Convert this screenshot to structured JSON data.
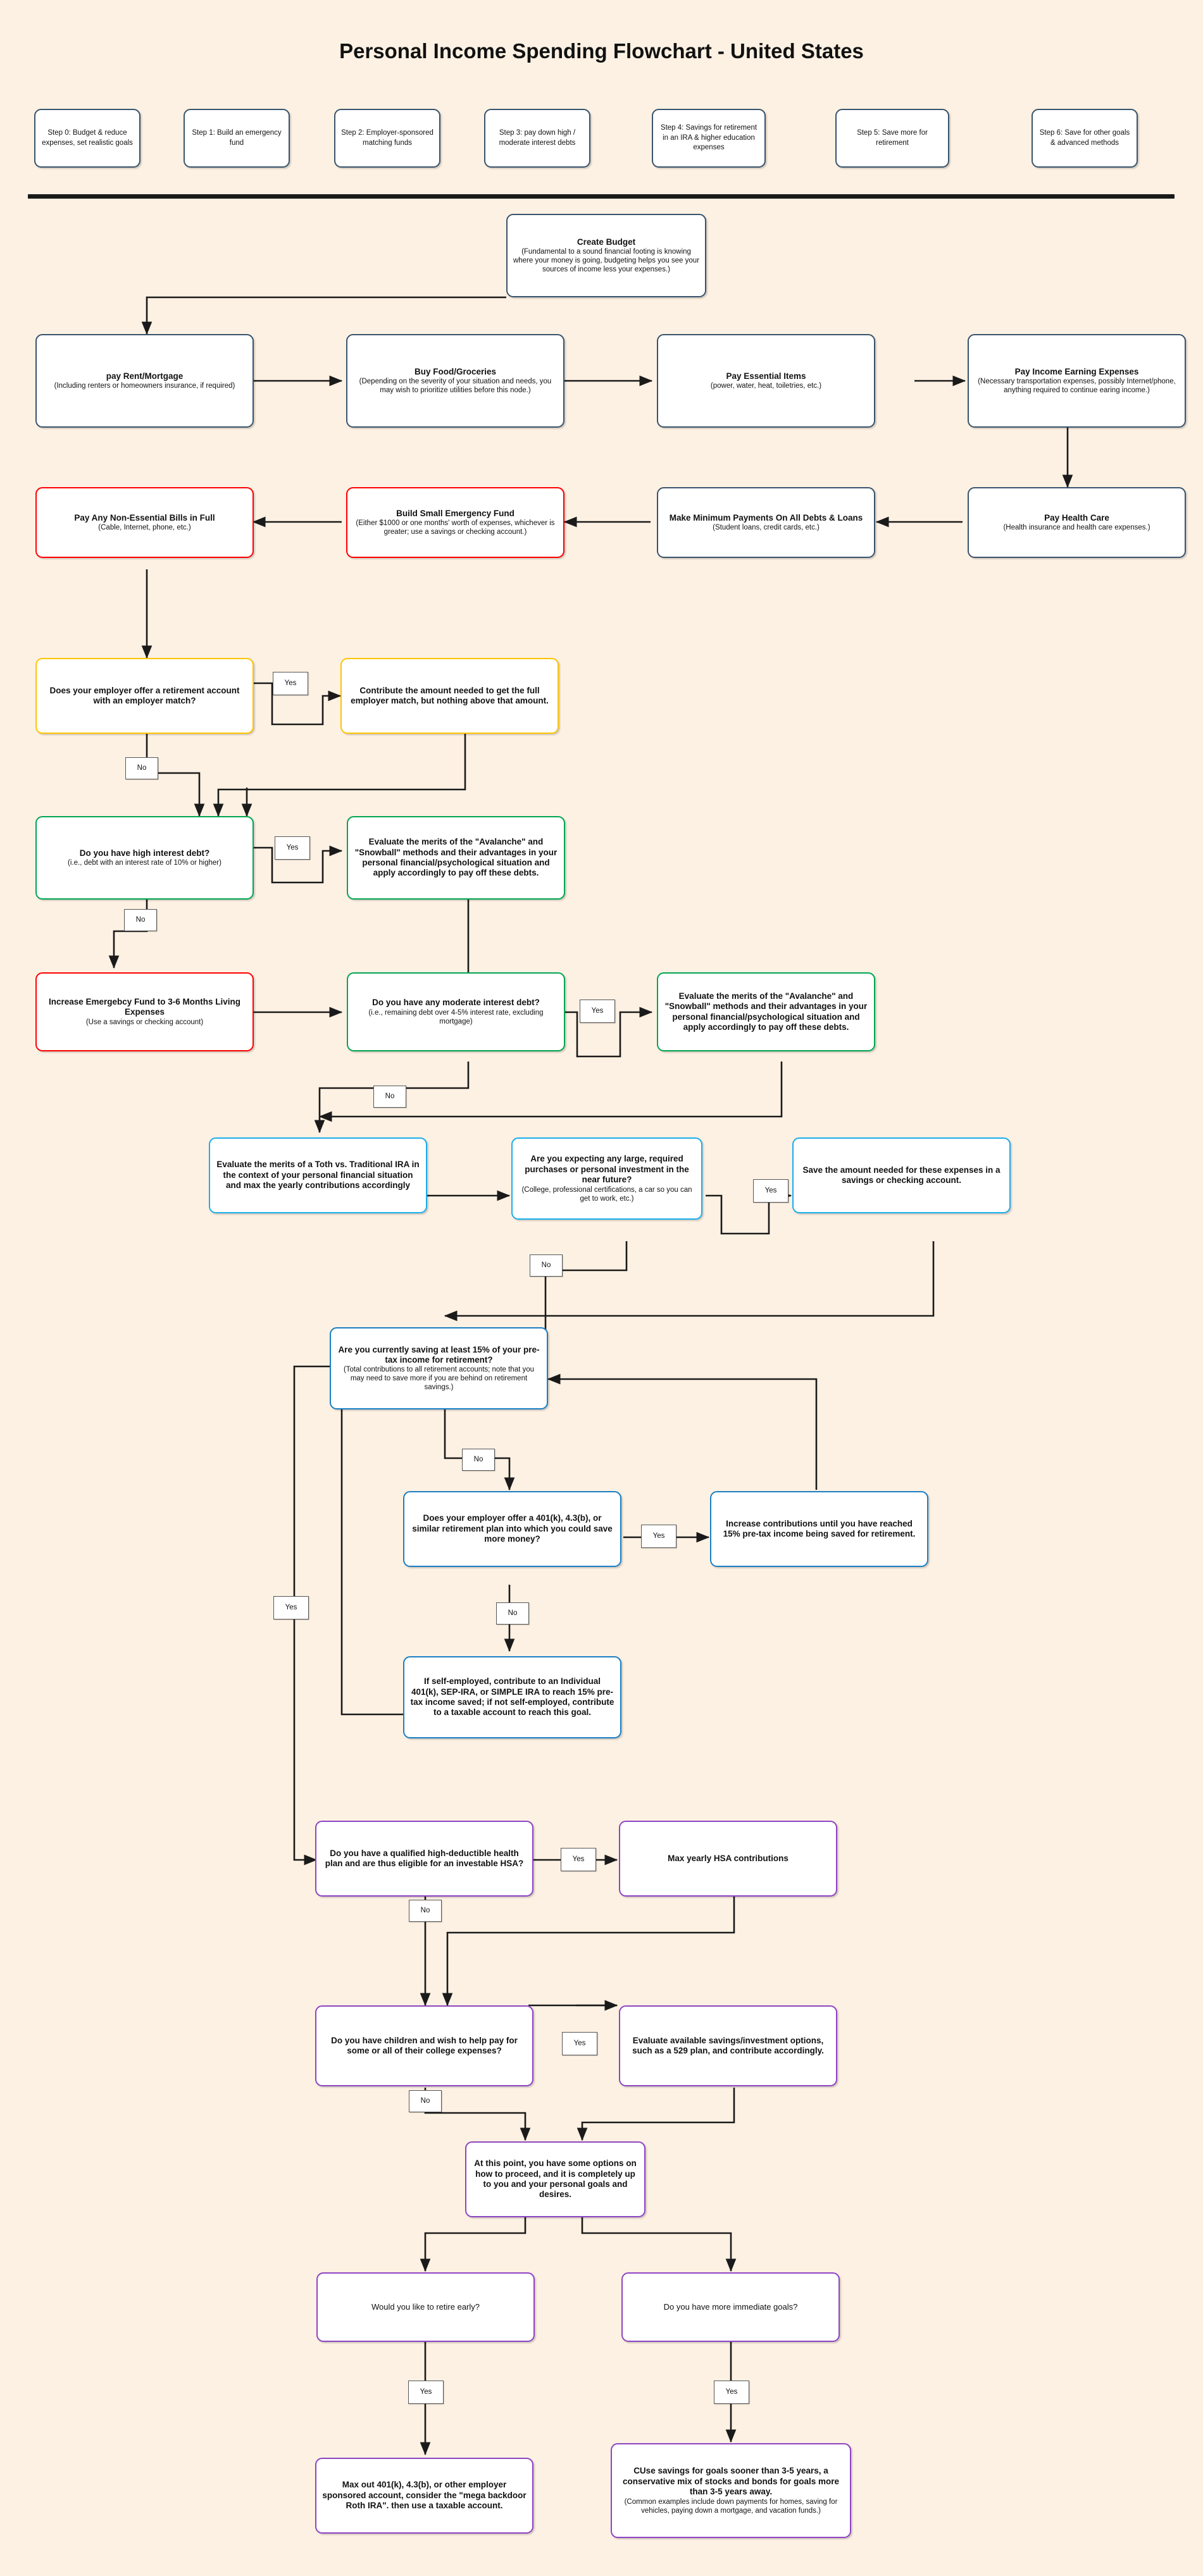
{
  "page": {
    "title": "Personal Income Spending Flowchart - United States",
    "background_color": "#fdf1e3"
  },
  "legend": {
    "items": [
      {
        "label": "Step 0: Budget & reduce expenses, set realistic goals",
        "color": "#39546d"
      },
      {
        "label": "Step 1: Build an emergency fund",
        "color": "#ff0000"
      },
      {
        "label": "Step 2: Employer-sponsored matching funds",
        "color": "#ffc400"
      },
      {
        "label": "Step 3: pay down high / moderate interest debts",
        "color": "#00a651"
      },
      {
        "label": "Step 4: Savings for retirement in an IRA & higher education expenses",
        "color": "#1aaeec"
      },
      {
        "label": "Step 5: Save more for retirement",
        "color": "#1a7fc4"
      },
      {
        "label": "Step 6: Save for other goals & advanced methods",
        "color": "#8e44c4"
      }
    ]
  },
  "nodes": {
    "create_budget": {
      "head": "Create Budget",
      "sub": "(Fundamental to a sound financial footing is knowing where your money is going, budgeting helps you see your sources of income less your expenses.)"
    },
    "rent_mortgage": {
      "head": "pay Rent/Mortgage",
      "sub": "(Including renters or homeowners insurance, if required)"
    },
    "food_groceries": {
      "head": "Buy Food/Groceries",
      "sub": "(Depending on the severity of your situation and needs, you may wish to prioritize utilities before this node.)"
    },
    "essential_items": {
      "head": "Pay Essential Items",
      "sub": "(power, water, heat, toiletries, etc.)"
    },
    "income_earning": {
      "head": "Pay Income Earning Expenses",
      "sub": "(Necessary transportation expenses, possibly Internet/phone, anything required to continue earing income.)"
    },
    "health_care": {
      "head": "Pay Health Care",
      "sub": "(Health insurance and health care expenses.)"
    },
    "min_payments": {
      "head": "Make Minimum Payments On All Debts & Loans",
      "sub": "(Student loans, credit cards, etc.)"
    },
    "small_emergency": {
      "head": "Build Small Emergency Fund",
      "sub": "(Either $1000 or one months' worth of expenses, whichever is greater; use a savings or checking account.)"
    },
    "non_essential": {
      "head": "Pay Any Non-Essential Bills in Full",
      "sub": "(Cable, Internet, phone, etc.)"
    },
    "employer_match_q": {
      "head": "Does your employer offer a retirement account with an employer match?",
      "sub": ""
    },
    "employer_match_a": {
      "head": "Contribute the amount needed to get the full employer match, but nothing above that amount.",
      "sub": ""
    },
    "high_interest_q": {
      "head": "Do you have high interest debt?",
      "sub": "(i.e., debt with an interest rate of 10% or higher)"
    },
    "high_interest_a": {
      "head": "Evaluate the merits of the \"Avalanche\" and \"Snowball\" methods and their advantages in your personal financial/psychological situation and apply accordingly to pay off these debts.",
      "sub": ""
    },
    "increase_emergency": {
      "head": "Increase Emergebcy Fund to 3-6 Months Living Expenses",
      "sub": "(Use a savings or checking account)"
    },
    "moderate_interest_q": {
      "head": "Do you have any moderate interest debt?",
      "sub": "(i.e., remaining debt over 4-5% interest rate, excluding mortgage)"
    },
    "moderate_interest_a": {
      "head": "Evaluate the merits of the \"Avalanche\" and \"Snowball\" methods and their advantages in your personal financial/psychological situation and apply accordingly to pay off these debts.",
      "sub": ""
    },
    "roth_vs_trad": {
      "head": "Evaluate the merits of a Toth vs. Traditional IRA in the context of your personal financial situation and max the yearly contributions accordingly",
      "sub": ""
    },
    "large_purchase_q": {
      "head": "Are you expecting any large, required purchases or personal investment in the near future?",
      "sub": "(College, professional certifications, a car so you can get to work, etc.)"
    },
    "large_purchase_a": {
      "head": "Save the amount needed for these expenses in a savings or checking account.",
      "sub": ""
    },
    "saving_15_q": {
      "head": "Are you currently saving at least 15% of your pre-tax income for retirement?",
      "sub": "(Total contributions to all retirement accounts; note that you may need to save more if you are behind on retirement savings.)"
    },
    "employer_401k_q": {
      "head": "Does your employer offer a 401(k), 4.3(b), or similar retirement plan into which you could save more money?",
      "sub": ""
    },
    "increase_contrib": {
      "head": "Increase contributions until you have reached 15% pre-tax income being saved for retirement.",
      "sub": ""
    },
    "self_employed": {
      "head": "If self-employed, contribute to an Individual 401(k), SEP-IRA, or SIMPLE IRA to reach 15% pre-tax income saved; if not self-employed, contribute to a taxable account to reach this goal.",
      "sub": ""
    },
    "hsa_q": {
      "head": "Do you have a qualified high-deductible health plan and are thus eligible for an investable HSA?",
      "sub": ""
    },
    "hsa_a": {
      "head": "Max yearly HSA contributions",
      "sub": ""
    },
    "college_q": {
      "head": "Do you have children and wish to help pay for some or all of their college expenses?",
      "sub": ""
    },
    "college_a": {
      "head": "Evaluate available savings/investment options, such as a 529 plan, and contribute accordingly.",
      "sub": ""
    },
    "options_note": {
      "head": "At this point, you have some options on how to proceed, and it is completely up to you and your personal goals and desires.",
      "sub": ""
    },
    "retire_early_q": {
      "head": "Would you like to retire early?",
      "sub": ""
    },
    "immediate_goals_q": {
      "head": "Do you have more immediate goals?",
      "sub": ""
    },
    "max_out": {
      "head": "Max out 401(k), 4.3(b), or other employer sponsored account, consider the \"mega backdoor Roth IRA\". then use a taxable account.",
      "sub": ""
    },
    "goal_savings": {
      "head": "CUse savings for goals sooner than 3-5 years, a conservative mix of stocks and bonds for goals more than 3-5 years away.",
      "sub": "(Common examples include down payments for homes, saving for vehicles, paying down a mortgage, and vacation funds.)"
    }
  },
  "edge_labels": {
    "yes_employer_match": "Yes",
    "no_employer_match": "No",
    "yes_high_interest": "Yes",
    "no_high_interest": "No",
    "yes_moderate": "Yes",
    "no_moderate": "No",
    "yes_large_purchase": "Yes",
    "no_large_purchase": "No",
    "no_saving_15": "No",
    "yes_saving_15": "Yes",
    "yes_401k": "Yes",
    "no_401k": "No",
    "yes_hsa": "Yes",
    "no_hsa": "No",
    "yes_college": "Yes",
    "no_college": "No",
    "yes_retire_early": "Yes",
    "yes_immediate_goals": "Yes"
  }
}
